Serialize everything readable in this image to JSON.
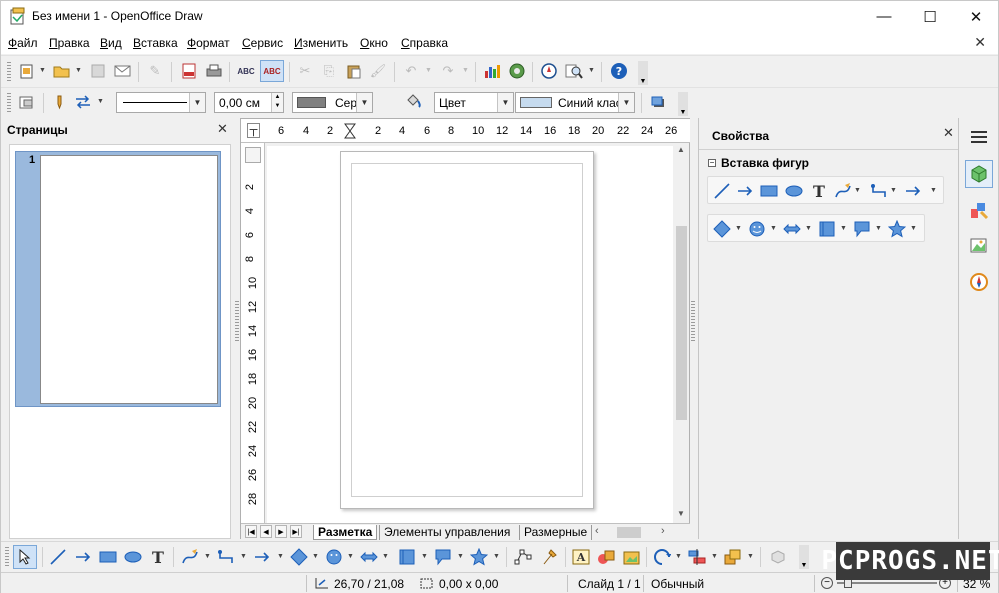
{
  "window": {
    "title": "Без имени 1 - OpenOffice Draw",
    "minimize": "—",
    "maximize": "☐",
    "close": "✕"
  },
  "menu": [
    "Файл",
    "Правка",
    "Вид",
    "Вставка",
    "Формат",
    "Сервис",
    "Изменить",
    "Окно",
    "Справка"
  ],
  "line_toolbar": {
    "line_width": "0,00 см",
    "area_color": "Серый",
    "fill_mode": "Цвет",
    "fill_color_value": "Синий клас",
    "colors": {
      "area_swatch": "#808080",
      "fill_swatch": "#c6dbef"
    }
  },
  "pages_panel": {
    "title": "Страницы",
    "close": "✕",
    "pages": [
      {
        "number": "1"
      }
    ]
  },
  "rulers": {
    "horizontal": [
      "6",
      "4",
      "2",
      "2",
      "4",
      "6",
      "8",
      "10",
      "12",
      "14",
      "16",
      "18",
      "20",
      "22",
      "24",
      "26"
    ],
    "vertical": [
      "2",
      "4",
      "6",
      "8",
      "10",
      "12",
      "14",
      "16",
      "18",
      "20",
      "22",
      "24",
      "26",
      "28"
    ]
  },
  "tabs": [
    "Разметка",
    "Элементы управления",
    "Размерные"
  ],
  "properties": {
    "title": "Свойства",
    "close": "✕",
    "section": "Вставка фигур",
    "section_toggle": "−"
  },
  "status": {
    "position": "26,70 / 21,08",
    "size": "0,00 x 0,00",
    "slide": "Слайд 1 / 1",
    "layout": "Обычный",
    "zoom": "32 %",
    "zoom_level": 0.32
  },
  "watermark": "PCPROGS.NET"
}
